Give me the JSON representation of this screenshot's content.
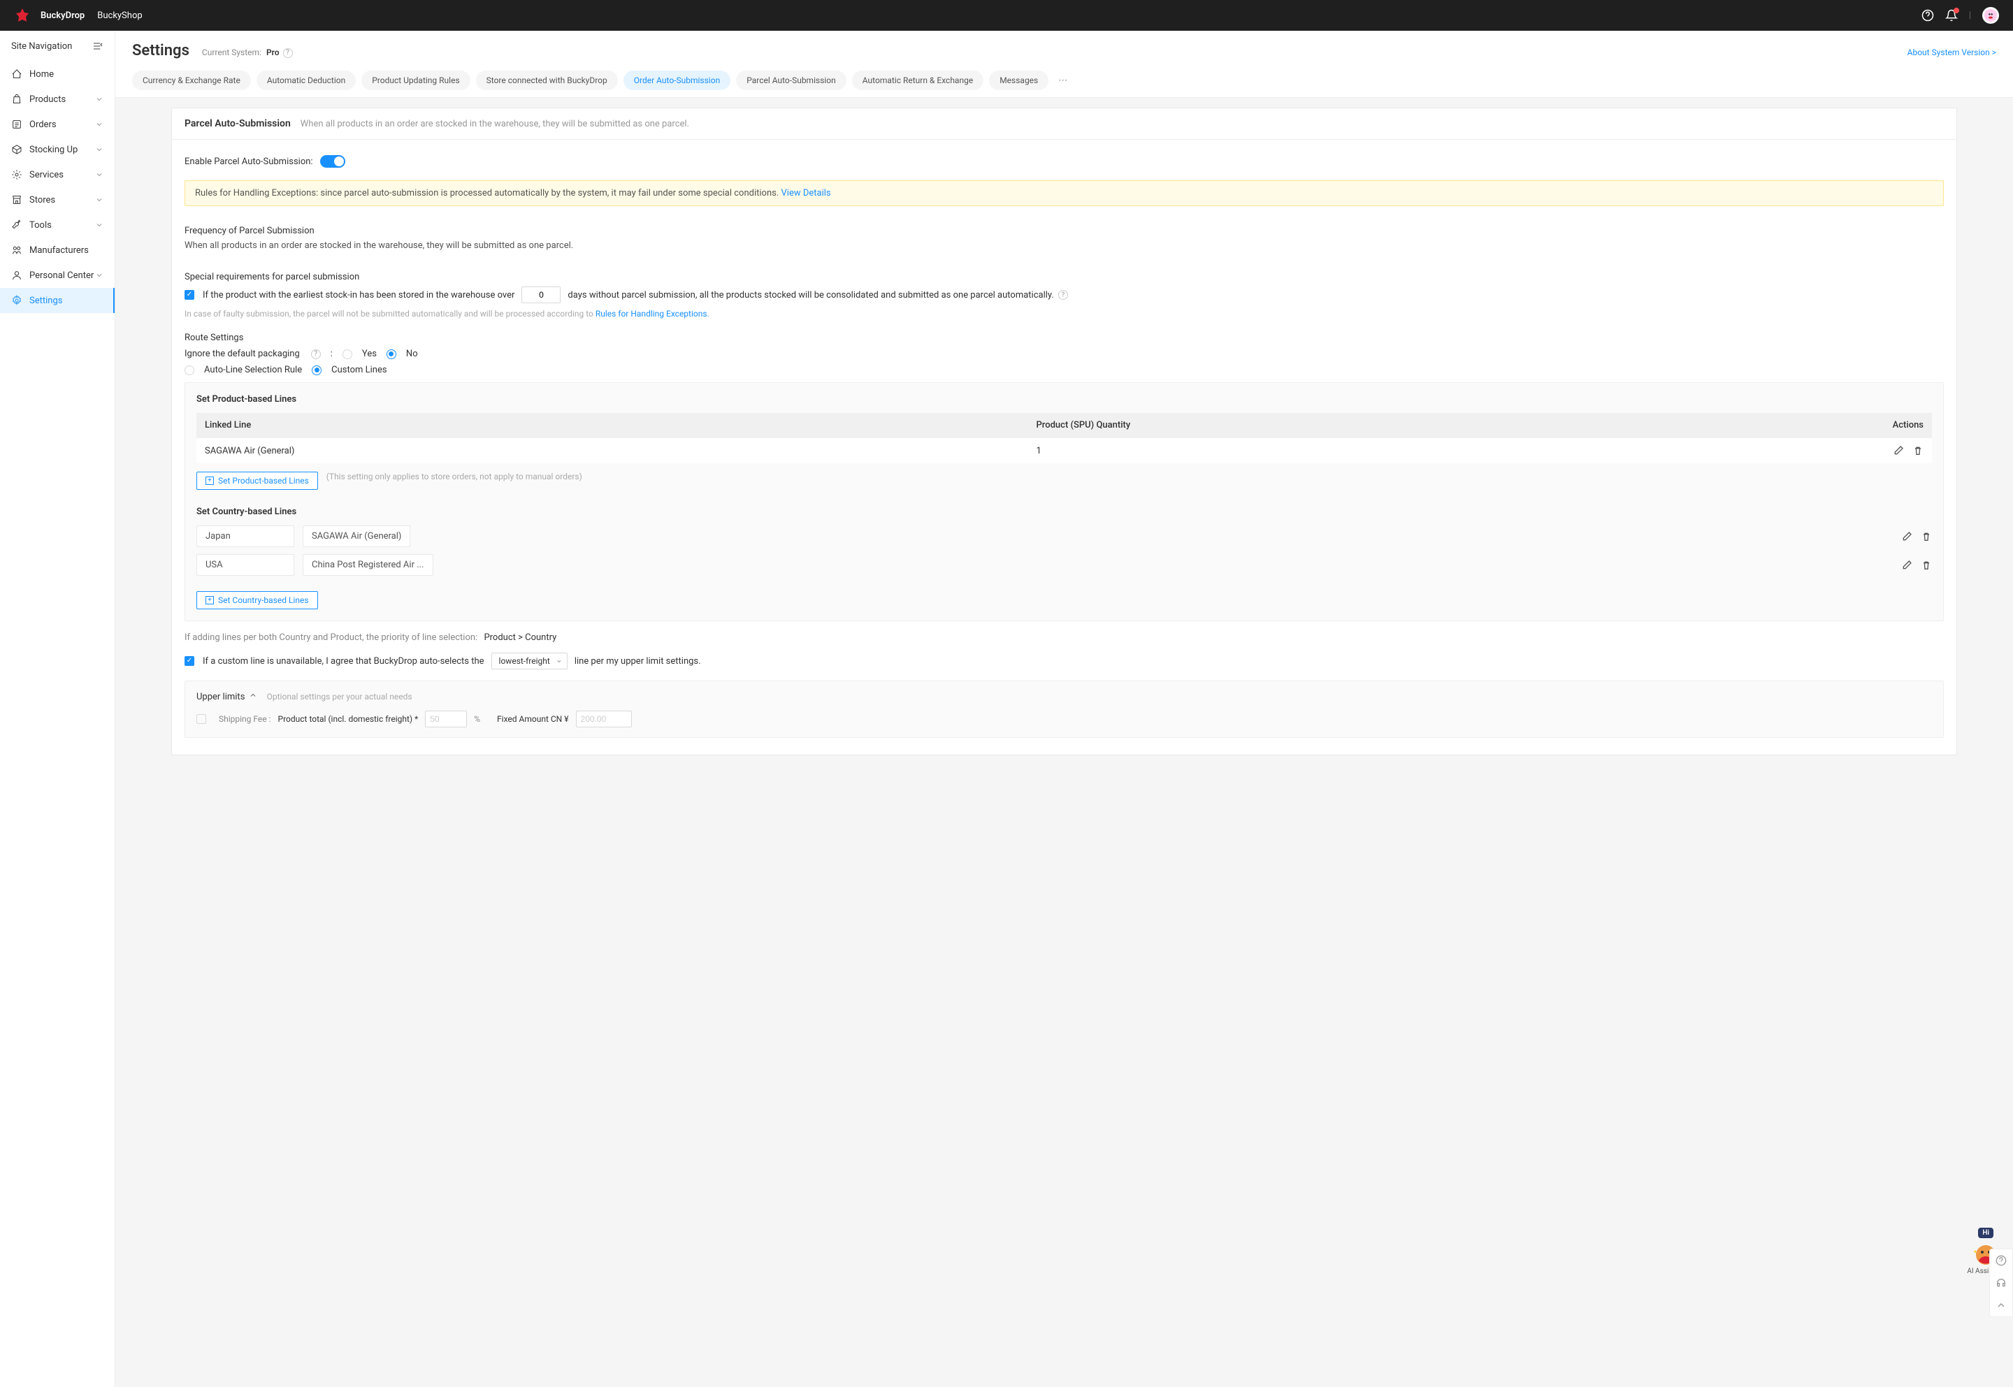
{
  "header": {
    "brand1": "BuckyDrop",
    "brand2": "BuckyShop"
  },
  "sidebar": {
    "title": "Site Navigation",
    "items": [
      {
        "label": "Home",
        "expandable": false
      },
      {
        "label": "Products",
        "expandable": true
      },
      {
        "label": "Orders",
        "expandable": true
      },
      {
        "label": "Stocking Up",
        "expandable": true
      },
      {
        "label": "Services",
        "expandable": true
      },
      {
        "label": "Stores",
        "expandable": true
      },
      {
        "label": "Tools",
        "expandable": true
      },
      {
        "label": "Manufacturers",
        "expandable": false
      },
      {
        "label": "Personal Center",
        "expandable": true
      },
      {
        "label": "Settings",
        "expandable": false,
        "active": true
      }
    ]
  },
  "page": {
    "title": "Settings",
    "current_system_label": "Current System:",
    "current_system_value": "Pro",
    "about_link": "About System Version >",
    "tabs": [
      "Currency & Exchange Rate",
      "Automatic Deduction",
      "Product Updating Rules",
      "Store connected with BuckyDrop",
      "Order Auto-Submission",
      "Parcel Auto-Submission",
      "Automatic Return & Exchange",
      "Messages"
    ],
    "active_tab_index": 4
  },
  "panel": {
    "title": "Parcel Auto-Submission",
    "desc": "When all products in an order are stocked in the warehouse, they will be submitted as one parcel.",
    "enable_label": "Enable Parcel Auto-Submission:",
    "alert_text": "Rules for Handling Exceptions: since parcel auto-submission is processed automatically by the system, it may fail under some special conditions. ",
    "alert_link": "View Details",
    "freq_title": "Frequency of Parcel Submission",
    "freq_desc": "When all products in an order are stocked in the warehouse, they will be submitted as one parcel.",
    "special_title": "Special requirements for parcel submission",
    "special_pre": "If the product with the earliest stock-in has been stored in the warehouse over",
    "special_days": "0",
    "special_post": "days without parcel submission, all the products stocked will be consolidated and submitted as one parcel automatically.",
    "faulty_note": "In case of faulty submission, the parcel will not be submitted automatically and will be processed according to ",
    "faulty_link": "Rules for Handling Exceptions.",
    "route_title": "Route Settings",
    "ignore_label": "Ignore the default packaging",
    "yes": "Yes",
    "no": "No",
    "auto_line": "Auto-Line Selection Rule",
    "custom_lines": "Custom Lines",
    "product_lines_title": "Set Product-based Lines",
    "col_line": "Linked Line",
    "col_qty": "Product (SPU) Quantity",
    "col_actions": "Actions",
    "product_rows": [
      {
        "line": "SAGAWA Air (General)",
        "qty": "1"
      }
    ],
    "btn_product_lines": "Set Product-based Lines",
    "product_hint": "(This setting only applies to store orders, not apply to manual orders)",
    "country_lines_title": "Set Country-based Lines",
    "country_rows": [
      {
        "country": "Japan",
        "line": "SAGAWA Air (General)"
      },
      {
        "country": "USA",
        "line": "China Post Registered Air ..."
      }
    ],
    "btn_country_lines": "Set Country-based Lines",
    "priority_text": "If adding lines per both Country and Product, the priority of line selection:",
    "priority_value": "Product > Country",
    "custom_unavail_pre": "If a custom line is unavailable, I agree that BuckyDrop auto-selects the",
    "custom_unavail_select": "lowest-freight",
    "custom_unavail_post": "line per my upper limit settings.",
    "upper_title": "Upper limits",
    "upper_hint": "Optional settings per your actual needs",
    "shipping_fee_label": "Shipping Fee :",
    "product_total_label": "Product total (incl. domestic freight) *",
    "percent_placeholder": "50",
    "percent_sign": "%",
    "fixed_amount_label": "Fixed Amount CN ¥",
    "fixed_placeholder": "200.00"
  },
  "assistant_label": "AI Assistant",
  "assistant_hi": "Hi"
}
